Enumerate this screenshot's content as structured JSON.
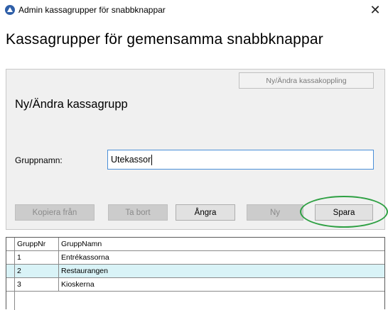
{
  "window": {
    "title": "Admin kassagrupper för snabbknappar",
    "close_glyph": "✕"
  },
  "page": {
    "title": "Kassagrupper för gemensamma snabbknappar"
  },
  "panel": {
    "kassakoppling_button": "Ny/Ändra kassakoppling",
    "heading": "Ny/Ändra kassagrupp",
    "name_label": "Gruppnamn:",
    "name_value": "Utekassor"
  },
  "buttons": {
    "copy": "Kopiera från",
    "delete": "Ta bort",
    "undo": "Ångra",
    "new": "Ny",
    "save": "Spara"
  },
  "highlight_color": "#2ea043",
  "grid": {
    "columns": [
      "GruppNr",
      "GruppNamn"
    ],
    "rows": [
      {
        "nr": "1",
        "name": "Entrékassorna"
      },
      {
        "nr": "2",
        "name": "Restaurangen"
      },
      {
        "nr": "3",
        "name": "Kioskerna"
      }
    ],
    "selected_row_color": "#d9f3f7"
  }
}
